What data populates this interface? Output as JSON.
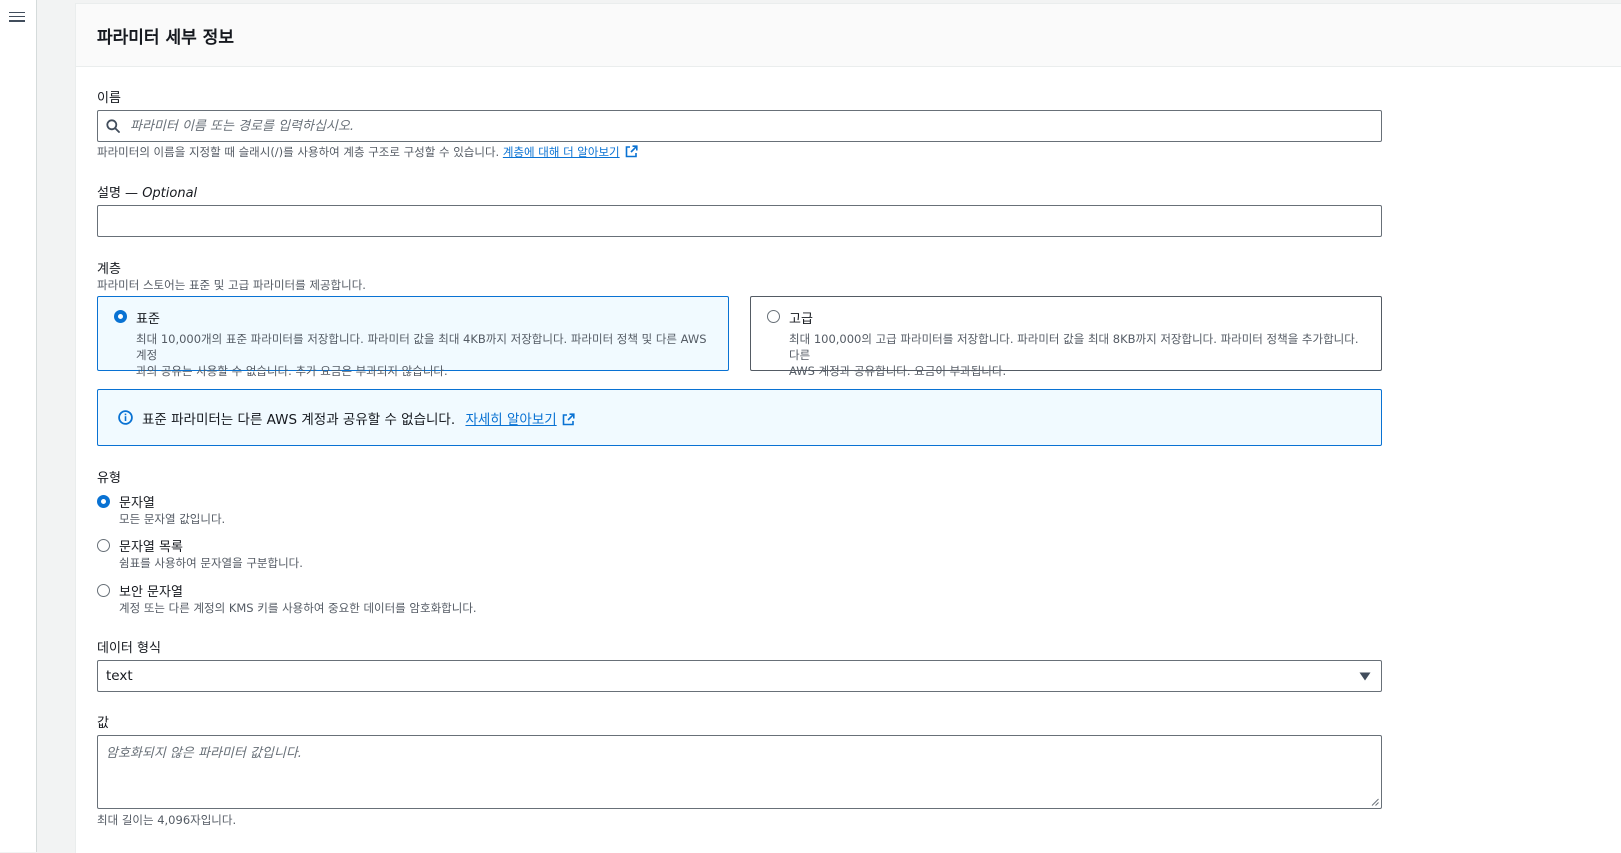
{
  "header": {
    "title": "파라미터 세부 정보"
  },
  "name": {
    "label": "이름",
    "placeholder": "파라미터 이름 또는 경로를 입력하십시오.",
    "hint": "파라미터의 이름을 지정할 때 슬래시(/)를 사용하여 계층 구조로 구성할 수 있습니다.",
    "hint_link": "계층에 대해 더 알아보기"
  },
  "description": {
    "label": "설명 — ",
    "optional": "Optional",
    "value": ""
  },
  "tier": {
    "label": "계층",
    "hint": "파라미터 스토어는 표준 및 고급 파라미터를 제공합니다.",
    "options": [
      {
        "title": "표준",
        "desc_line1": "최대 10,000개의 표준 파라미터를 저장합니다. 파라미터 값을 최대 4KB까지 저장합니다. 파라미터 정책 및 다른 AWS 계정",
        "desc_line2": "과의 공유는 사용할 수 없습니다. 추가 요금은 부과되지 않습니다.",
        "selected": true
      },
      {
        "title": "고급",
        "desc_line1": "최대 100,000의 고급 파라미터를 저장합니다. 파라미터 값을 최대 8KB까지 저장합니다. 파라미터 정책을 추가합니다. 다른",
        "desc_line2": "AWS 계정과 공유합니다. 요금이 부과됩니다.",
        "selected": false
      }
    ]
  },
  "alert": {
    "text": "표준 파라미터는 다른 AWS 계정과 공유할 수 없습니다.",
    "link": "자세히 알아보기"
  },
  "type": {
    "label": "유형",
    "options": [
      {
        "title": "문자열",
        "desc": "모든 문자열 값입니다.",
        "selected": true
      },
      {
        "title": "문자열 목록",
        "desc": "쉼표를 사용하여 문자열을 구분합니다.",
        "selected": false
      },
      {
        "title": "보안 문자열",
        "desc": "계정 또는 다른 계정의 KMS 키를 사용하여 중요한 데이터를 암호화합니다.",
        "selected": false
      }
    ]
  },
  "data_format": {
    "label": "데이터 형식",
    "selected": "text"
  },
  "value": {
    "label": "값",
    "placeholder": "암호화되지 않은 파라미터 값입니다.",
    "hint": "최대 길이는 4,096자입니다."
  },
  "colors": {
    "accent": "#0972d3",
    "alert_bg": "#f1faff",
    "border": "#687078"
  }
}
